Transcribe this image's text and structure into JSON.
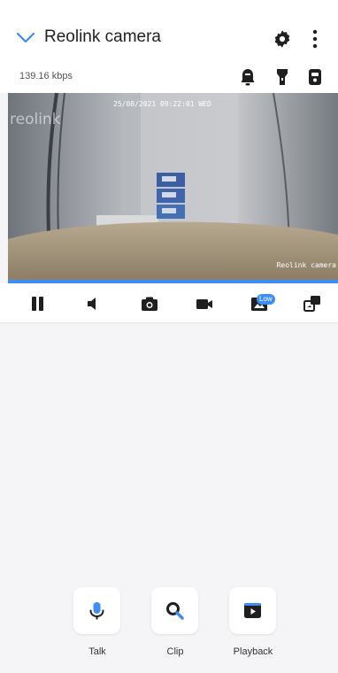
{
  "header": {
    "title": "Reolink camera",
    "bitrate": "139.16 kbps"
  },
  "video": {
    "timestamp": "25/08/2021 09:22:01 WED",
    "watermark": "reolink",
    "camera_label": "Reolink camera"
  },
  "toolbar": {
    "quality_badge": "Low"
  },
  "actions": {
    "talk_label": "Talk",
    "clip_label": "Clip",
    "playback_label": "Playback"
  },
  "colors": {
    "accent": "#3d8df5",
    "background": "#f5f5f7",
    "icon": "#1f1f1f"
  }
}
